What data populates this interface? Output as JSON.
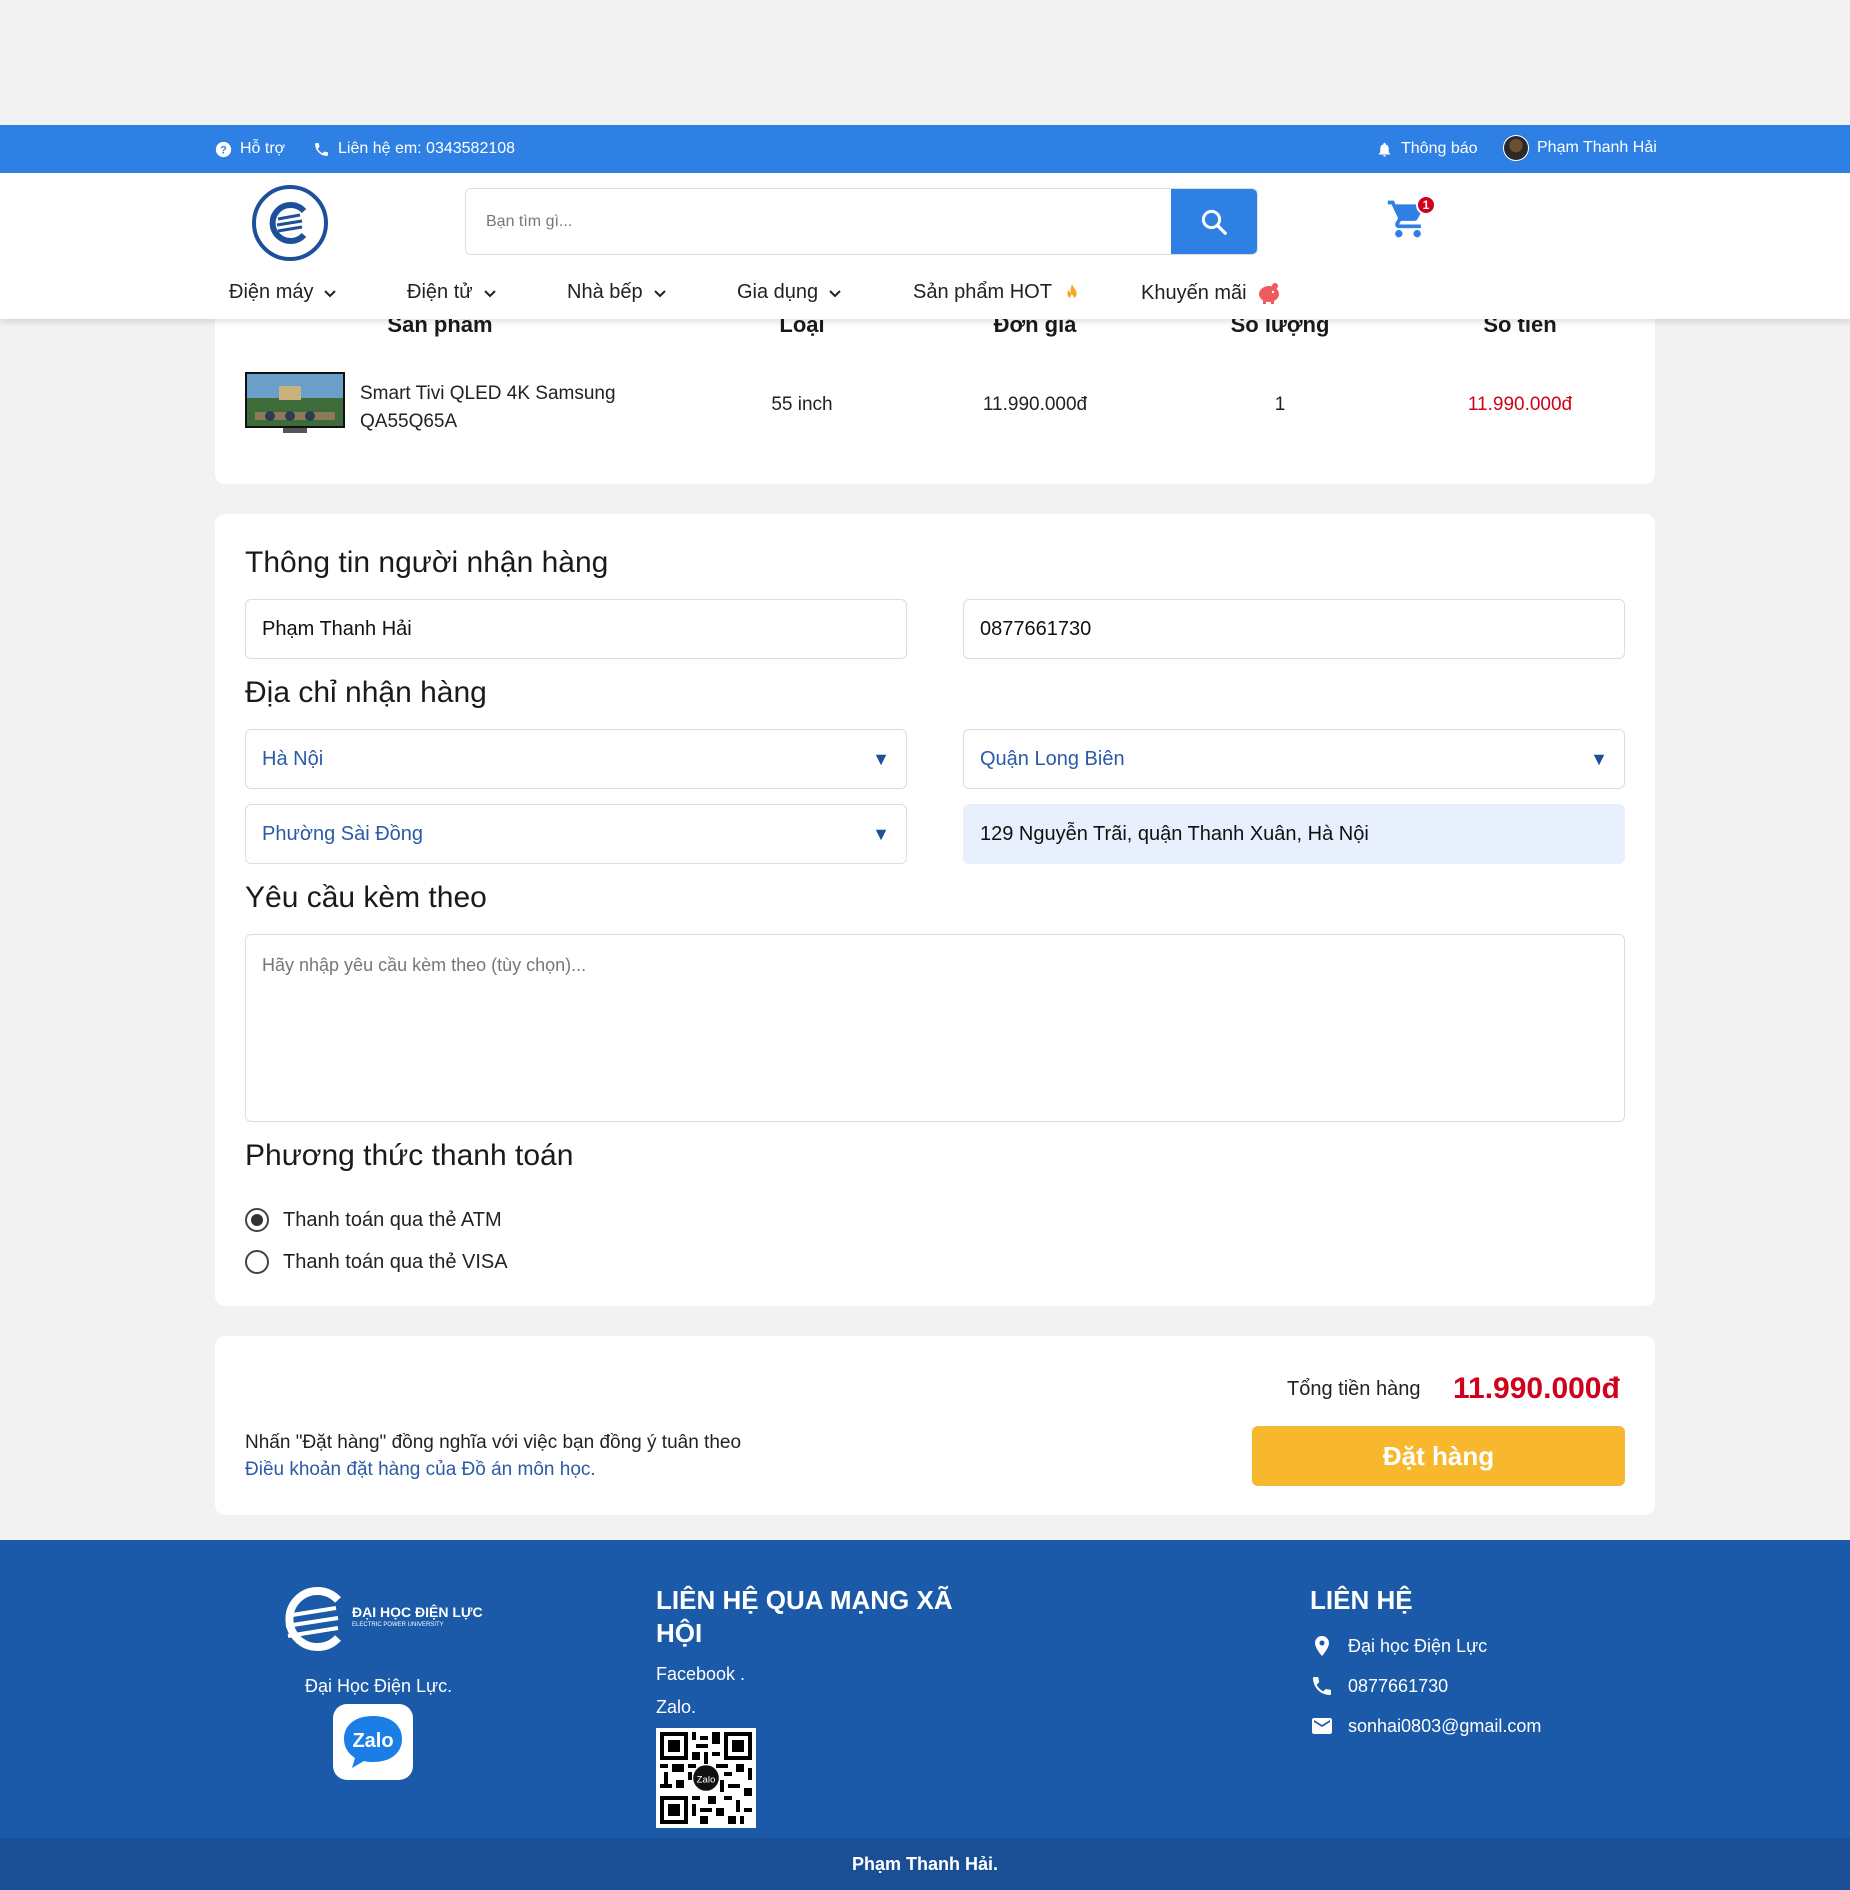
{
  "topbar": {
    "support": "Hỗ trợ",
    "contact": "Liên hệ em: 0343582108",
    "notifications": "Thông báo",
    "user_name": "Phạm Thanh Hải"
  },
  "header": {
    "search_placeholder": "Bạn tìm gì...",
    "cart_count": "1",
    "nav": [
      {
        "label": "Điện máy"
      },
      {
        "label": "Điện tử"
      },
      {
        "label": "Nhà bếp"
      },
      {
        "label": "Gia dụng"
      },
      {
        "label": "Sản phẩm HOT"
      },
      {
        "label": "Khuyến mãi"
      }
    ]
  },
  "cart_table": {
    "headers": [
      "Sản phẩm",
      "Loại",
      "Đơn giá",
      "Số lượng",
      "Số tiền"
    ],
    "row": {
      "product_line1": "Smart Tivi QLED 4K Samsung",
      "product_line2": "QA55Q65A",
      "type": "55 inch",
      "unit_price": "11.990.000đ",
      "quantity": "1",
      "amount": "11.990.000đ"
    }
  },
  "recipient": {
    "title": "Thông tin người nhận hàng",
    "name": "Phạm Thanh Hải",
    "phone": "0877661730"
  },
  "address": {
    "title": "Địa chỉ nhận hàng",
    "province": "Hà Nội",
    "district": "Quận Long Biên",
    "ward": "Phường Sài Đồng",
    "street": "129 Nguyễn Trãi, quận Thanh Xuân, Hà Nội"
  },
  "request": {
    "title": "Yêu cầu kèm theo",
    "placeholder": "Hãy nhập yêu cầu kèm theo (tùy chọn)..."
  },
  "payment": {
    "title": "Phương thức thanh toán",
    "options": [
      {
        "label": "Thanh toán qua thẻ ATM",
        "selected": true
      },
      {
        "label": "Thanh toán qua thẻ VISA",
        "selected": false
      }
    ]
  },
  "summary": {
    "total_label": "Tổng tiền hàng",
    "total_value": "11.990.000đ",
    "terms_line1": "Nhấn \"Đặt hàng\" đồng nghĩa với việc bạn đồng ý tuân theo",
    "terms_link": "Điều khoản đặt hàng của Đồ án môn học.",
    "order_button": "Đặt hàng"
  },
  "footer": {
    "logo_text": "ĐẠI HỌC ĐIỆN LỰC",
    "logo_subtext": "ELECTRIC POWER UNIVERSITY",
    "school_name": "Đại Học Điện Lực.",
    "zalo_label": "Zalo",
    "social_title": "LIÊN HỆ QUA MẠNG XÃ HỘI",
    "facebook": "Facebook .",
    "zalo": "Zalo.",
    "contact_title": "LIÊN HỆ",
    "contact_address": "Đại học Điện Lực",
    "contact_phone": "0877661730",
    "contact_email": "sonhai0803@gmail.com",
    "copyright": "Phạm Thanh Hải."
  },
  "colors": {
    "primary": "#2f80e4",
    "footer": "#1a5aa8",
    "price_red": "#d0021b",
    "order_button": "#f8b82e"
  }
}
